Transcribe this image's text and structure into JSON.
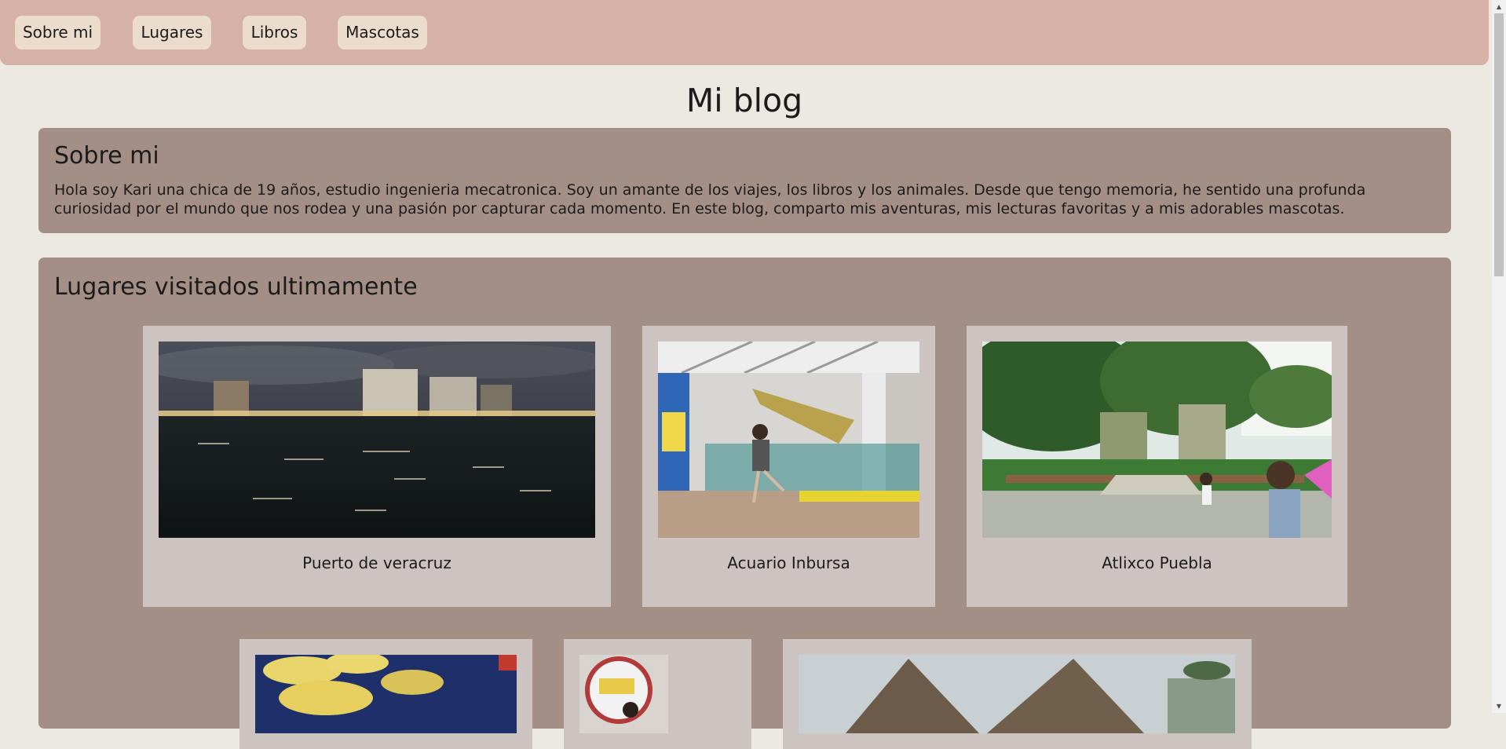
{
  "nav": {
    "items": [
      "Sobre mi",
      "Lugares",
      "Libros",
      "Mascotas"
    ]
  },
  "page": {
    "title": "Mi blog"
  },
  "about": {
    "heading": "Sobre mi",
    "text": "Hola soy Kari una chica de 19 años, estudio ingenieria mecatronica. Soy un amante de los viajes, los libros y los animales. Desde que tengo memoria, he sentido una profunda curiosidad por el mundo que nos rodea y una pasión por capturar cada momento. En este blog, comparto mis aventuras, mis lecturas favoritas y a mis adorables mascotas."
  },
  "places": {
    "heading": "Lugares visitados ultimamente",
    "cards": [
      {
        "caption": "Puerto de veracruz"
      },
      {
        "caption": "Acuario Inbursa"
      },
      {
        "caption": "Atlixco Puebla"
      }
    ]
  },
  "colors": {
    "navbar": "#d5b1a8",
    "nav_button": "#ecdccc",
    "background": "#ece8e2",
    "section": "#a48f86",
    "card": "#cdc4c1"
  }
}
